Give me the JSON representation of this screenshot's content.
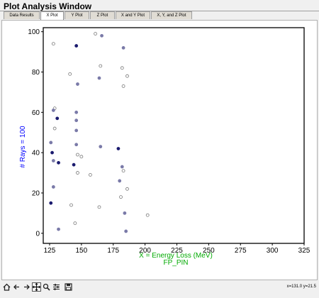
{
  "window": {
    "title": "Plot Analysis Window"
  },
  "tabs": [
    {
      "label": "Data Results",
      "active": false
    },
    {
      "label": "X Plot",
      "active": true
    },
    {
      "label": "Y Plot",
      "active": false
    },
    {
      "label": "Z Plot",
      "active": false
    },
    {
      "label": "X and Y Plot",
      "active": false
    },
    {
      "label": "X, Y, and Z Plot",
      "active": false
    }
  ],
  "plot": {
    "xlabel": "X = Energy Loss (MeV)",
    "subtitle": "FP_PIN",
    "ylabel": "# Rays = 100"
  },
  "colors": {
    "xlabel": "#00aa00",
    "ylabel": "#0000ff",
    "point_dark": "#1a1a6e",
    "point_mid": "#7a7aa8",
    "point_light": "#ffffff"
  },
  "toolbar": {
    "icons": [
      "home-icon",
      "back-arrow-icon",
      "forward-arrow-icon",
      "pan-icon",
      "zoom-icon",
      "configure-subplots-icon",
      "save-icon"
    ]
  },
  "status": {
    "coords": "x=131.0 y=21.5"
  },
  "chart_data": {
    "type": "scatter",
    "xlabel": "X = Energy Loss (MeV)",
    "ylabel": "# Rays = 100",
    "xlim": [
      120,
      325
    ],
    "ylim": [
      -5,
      102
    ],
    "xticks": [
      125,
      150,
      175,
      200,
      225,
      250,
      275,
      300,
      325
    ],
    "yticks": [
      0,
      20,
      40,
      60,
      80,
      100
    ],
    "grid": false,
    "points": [
      {
        "x": 161,
        "y": 99,
        "s": "light"
      },
      {
        "x": 166,
        "y": 98,
        "s": "mid"
      },
      {
        "x": 128,
        "y": 94,
        "s": "light"
      },
      {
        "x": 146,
        "y": 93,
        "s": "dark"
      },
      {
        "x": 183,
        "y": 92,
        "s": "mid"
      },
      {
        "x": 165,
        "y": 83,
        "s": "light"
      },
      {
        "x": 182,
        "y": 82,
        "s": "light"
      },
      {
        "x": 141,
        "y": 79,
        "s": "light"
      },
      {
        "x": 186,
        "y": 78,
        "s": "light"
      },
      {
        "x": 164,
        "y": 77,
        "s": "mid"
      },
      {
        "x": 147,
        "y": 74,
        "s": "mid"
      },
      {
        "x": 183,
        "y": 73,
        "s": "light"
      },
      {
        "x": 129,
        "y": 62,
        "s": "light"
      },
      {
        "x": 128,
        "y": 61,
        "s": "mid"
      },
      {
        "x": 146,
        "y": 60,
        "s": "mid"
      },
      {
        "x": 131,
        "y": 57,
        "s": "dark"
      },
      {
        "x": 146,
        "y": 56,
        "s": "mid"
      },
      {
        "x": 129,
        "y": 52,
        "s": "light"
      },
      {
        "x": 146,
        "y": 51,
        "s": "mid"
      },
      {
        "x": 126,
        "y": 45,
        "s": "mid"
      },
      {
        "x": 146,
        "y": 44,
        "s": "mid"
      },
      {
        "x": 165,
        "y": 43,
        "s": "mid"
      },
      {
        "x": 179,
        "y": 42,
        "s": "dark"
      },
      {
        "x": 127,
        "y": 40,
        "s": "dark"
      },
      {
        "x": 147,
        "y": 39,
        "s": "light"
      },
      {
        "x": 150,
        "y": 38,
        "s": "light"
      },
      {
        "x": 128,
        "y": 36,
        "s": "mid"
      },
      {
        "x": 132,
        "y": 35,
        "s": "dark"
      },
      {
        "x": 144,
        "y": 34,
        "s": "dark"
      },
      {
        "x": 182,
        "y": 33,
        "s": "mid"
      },
      {
        "x": 183,
        "y": 31,
        "s": "light"
      },
      {
        "x": 147,
        "y": 30,
        "s": "light"
      },
      {
        "x": 157,
        "y": 29,
        "s": "light"
      },
      {
        "x": 180,
        "y": 26,
        "s": "mid"
      },
      {
        "x": 128,
        "y": 23,
        "s": "mid"
      },
      {
        "x": 186,
        "y": 22,
        "s": "light"
      },
      {
        "x": 181,
        "y": 18,
        "s": "light"
      },
      {
        "x": 126,
        "y": 15,
        "s": "dark"
      },
      {
        "x": 142,
        "y": 14,
        "s": "light"
      },
      {
        "x": 164,
        "y": 13,
        "s": "light"
      },
      {
        "x": 184,
        "y": 10,
        "s": "mid"
      },
      {
        "x": 202,
        "y": 9,
        "s": "light"
      },
      {
        "x": 145,
        "y": 5,
        "s": "light"
      },
      {
        "x": 132,
        "y": 2,
        "s": "mid"
      },
      {
        "x": 185,
        "y": 1,
        "s": "mid"
      }
    ]
  }
}
